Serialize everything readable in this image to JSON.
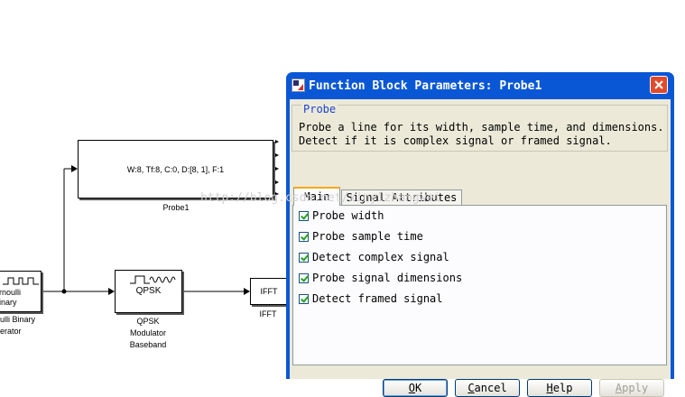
{
  "watermark": "http://blog.csdn.net/xinyizhangwei",
  "model": {
    "bernoulli_block": {
      "label_line1": "rnoulli",
      "label_line2": "inary",
      "caption_line1": "ulli Binary",
      "caption_line2": "erator"
    },
    "probe_block": {
      "display": "W:8, Tf:8, C:0, D:[8, 1], F:1",
      "caption": "Probe1"
    },
    "qpsk_block": {
      "label": "QPSK",
      "caption_line1": "QPSK",
      "caption_line2": "Modulator",
      "caption_line3": "Baseband"
    },
    "ifft_block": {
      "label": "IFFT",
      "caption": "IFFT"
    }
  },
  "dialog": {
    "title": "Function Block Parameters: Probe1",
    "group_title": "Probe",
    "description_line1": "Probe a line for its width, sample time, and dimensions.",
    "description_line2": "Detect if it is complex signal or framed signal.",
    "tabs": [
      {
        "label": "Main",
        "active": true
      },
      {
        "label": "Signal Attributes",
        "active": false
      }
    ],
    "options": [
      {
        "label": "Probe width",
        "checked": true
      },
      {
        "label": "Probe sample time",
        "checked": true
      },
      {
        "label": "Detect complex signal",
        "checked": true
      },
      {
        "label": "Probe signal dimensions",
        "checked": true
      },
      {
        "label": "Detect framed signal",
        "checked": true
      }
    ],
    "buttons": {
      "ok": {
        "mnemonic": "O",
        "rest": "K"
      },
      "cancel": {
        "mnemonic": "C",
        "rest": "ancel"
      },
      "help": {
        "mnemonic": "H",
        "rest": "elp"
      },
      "apply": {
        "mnemonic": "A",
        "rest": "pply",
        "disabled": true
      }
    }
  },
  "colors": {
    "titlebar": "#0a57d6",
    "dialog_face": "#ece9d8",
    "group_title": "#1b44d0",
    "check": "#21a121",
    "close_button": "#e04b2c"
  }
}
